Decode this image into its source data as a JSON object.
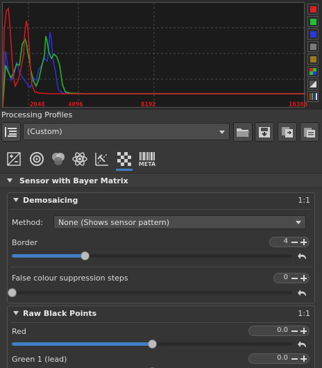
{
  "histogram": {
    "ticks": [
      "2048",
      "4096",
      "8192",
      "16383"
    ],
    "buttons": [
      {
        "name": "red-channel-button",
        "color": "#e02020"
      },
      {
        "name": "green-channel-button",
        "color": "#22c233"
      },
      {
        "name": "blue-channel-button",
        "color": "#2a38e0"
      },
      {
        "name": "luminance-button",
        "color": "#7a7a7a"
      },
      {
        "name": "chroma-button",
        "color": "#9a7a20"
      },
      {
        "name": "raw-histogram-button",
        "color": "raw"
      },
      {
        "name": "bar-mode-button",
        "color": "mode"
      },
      {
        "name": "pointer-rgb-button",
        "color": "bars"
      }
    ]
  },
  "profiles": {
    "title": "Processing Profiles",
    "selected": "(Custom)"
  },
  "tabs": {
    "meta_label": "META"
  },
  "sensor": {
    "title": "Sensor with Bayer Matrix"
  },
  "demosaicing": {
    "title": "Demosaicing",
    "ratio": "1:1",
    "method_label": "Method:",
    "method_value": "None (Shows sensor pattern)",
    "border_label": "Border",
    "border_value": "4",
    "border_fraction": 0.26,
    "false_colour_label": "False colour suppression steps",
    "false_colour_value": "0",
    "false_colour_fraction": 0.0
  },
  "raw_black": {
    "title": "Raw Black Points",
    "ratio": "1:1",
    "red_label": "Red",
    "red_value": "0.0",
    "red_fraction": 0.5,
    "green1_label": "Green 1 (lead)",
    "green1_value": "0.0",
    "green1_fraction": 0.5
  }
}
